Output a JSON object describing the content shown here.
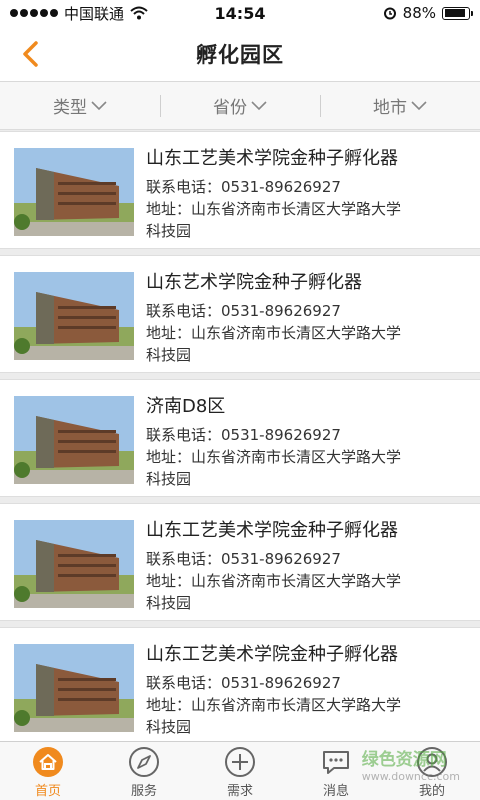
{
  "status_bar": {
    "carrier": "中国联通",
    "time": "14:54",
    "battery": "88%",
    "battery_level": 0.88
  },
  "nav": {
    "title": "孵化园区",
    "back_icon": "chevron-left-icon",
    "accent_color": "#f08a1e"
  },
  "filters": [
    {
      "label": "类型"
    },
    {
      "label": "省份"
    },
    {
      "label": "地市"
    }
  ],
  "list": [
    {
      "title": "山东工艺美术学院金种子孵化器",
      "phone": "联系电话：0531-89626927",
      "address_1": "地址：山东省济南市长清区大学路大学",
      "address_2": "科技园"
    },
    {
      "title": "山东艺术学院金种子孵化器",
      "phone": "联系电话：0531-89626927",
      "address_1": "地址：山东省济南市长清区大学路大学",
      "address_2": "科技园"
    },
    {
      "title": "济南D8区",
      "phone": "联系电话：0531-89626927",
      "address_1": "地址：山东省济南市长清区大学路大学",
      "address_2": "科技园"
    },
    {
      "title": "山东工艺美术学院金种子孵化器",
      "phone": "联系电话：0531-89626927",
      "address_1": "地址：山东省济南市长清区大学路大学",
      "address_2": "科技园"
    },
    {
      "title": "山东工艺美术学院金种子孵化器",
      "phone": "联系电话：0531-89626927",
      "address_1": "地址：山东省济南市长清区大学路大学",
      "address_2": "科技园"
    }
  ],
  "tabs": [
    {
      "label": "首页",
      "icon": "home-icon",
      "active": true
    },
    {
      "label": "服务",
      "icon": "compass-icon",
      "active": false
    },
    {
      "label": "需求",
      "icon": "plus-circle-icon",
      "active": false
    },
    {
      "label": "消息",
      "icon": "chat-bubble-icon",
      "active": false
    },
    {
      "label": "我的",
      "icon": "user-icon",
      "active": false
    }
  ],
  "watermark": {
    "line1": "绿色资源网",
    "line2": "www.downcc.com"
  }
}
